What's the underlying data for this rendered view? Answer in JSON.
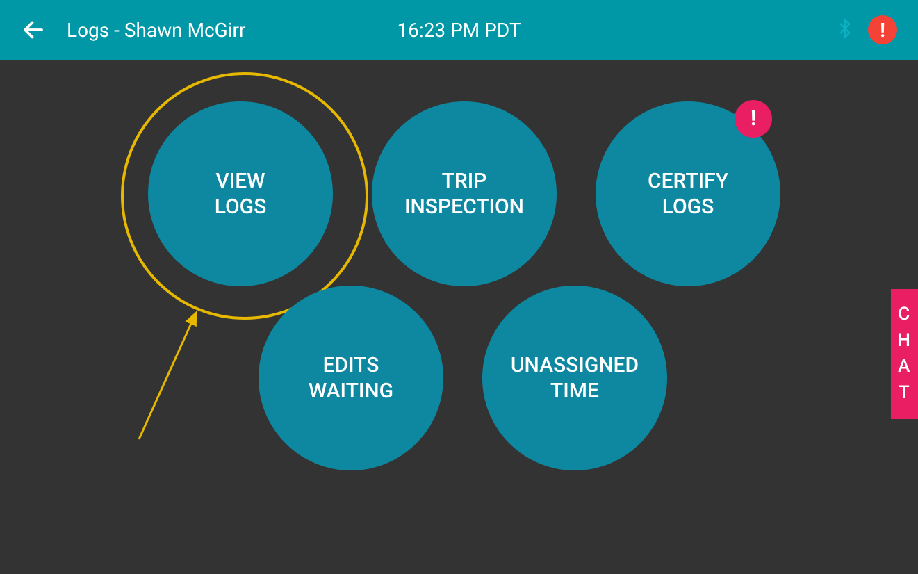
{
  "header": {
    "title": "Logs - Shawn McGirr",
    "time": "16:23 PM PDT",
    "alert": "!"
  },
  "buttons": {
    "viewLogs": "VIEW\nLOGS",
    "tripInspection": "TRIP\nINSPECTION",
    "certifyLogs": "CERTIFY\nLOGS",
    "certifyBadge": "!",
    "editsWaiting": "EDITS\nWAITING",
    "unassignedTime": "UNASSIGNED\nTIME"
  },
  "chat": {
    "c1": "C",
    "c2": "H",
    "c3": "A",
    "c4": "T"
  }
}
